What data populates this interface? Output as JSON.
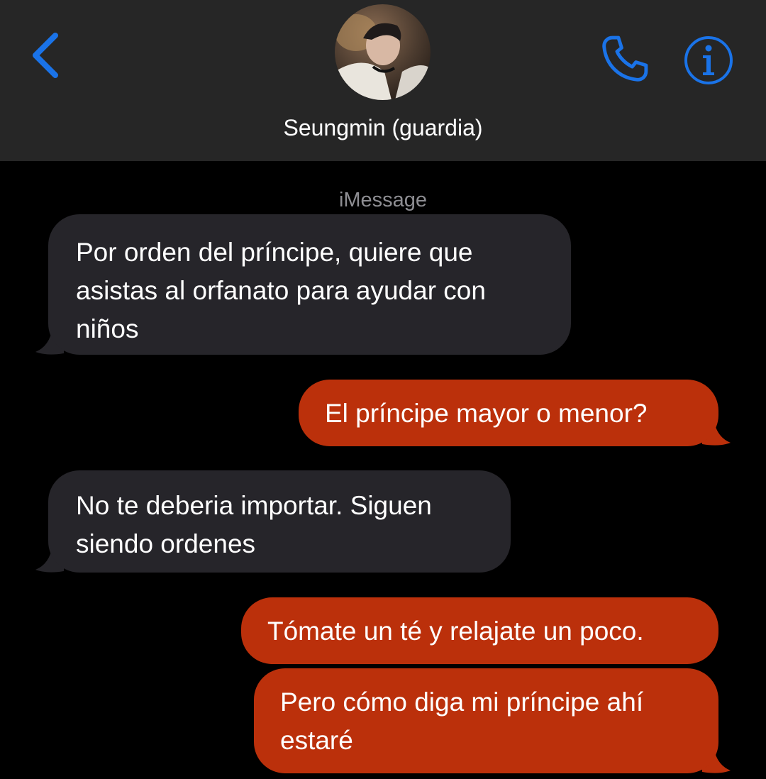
{
  "header": {
    "contact_name": "Seungmin (guardia)",
    "back_icon": "chevron-left-icon",
    "call_icon": "phone-icon",
    "info_icon": "info-icon",
    "accent_color": "#1a73e8"
  },
  "conversation": {
    "service_label": "iMessage",
    "received_color": "#26252a",
    "sent_color": "#bb300b",
    "messages": [
      {
        "sender": "contact",
        "text": "Por orden del príncipe, quiere que\nasistas al orfanato para ayudar con\nniños"
      },
      {
        "sender": "me",
        "text": "El príncipe mayor o menor?"
      },
      {
        "sender": "contact",
        "text": "No te deberia importar. Siguen\nsiendo ordenes"
      },
      {
        "sender": "me",
        "text": "Tómate un té y relajate un poco."
      },
      {
        "sender": "me",
        "text": "Pero cómo diga mi príncipe ahí\nestaré"
      }
    ]
  }
}
